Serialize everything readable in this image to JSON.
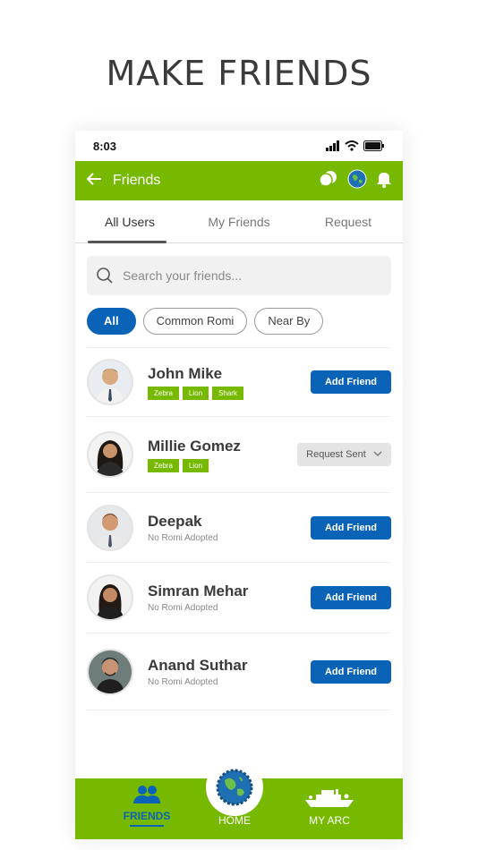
{
  "headline": "MAKE FRIENDS",
  "status": {
    "time": "8:03"
  },
  "appbar": {
    "title": "Friends"
  },
  "tabs": [
    {
      "label": "All Users",
      "active": true
    },
    {
      "label": "My Friends",
      "active": false
    },
    {
      "label": "Request",
      "active": false
    }
  ],
  "search": {
    "placeholder": "Search your friends..."
  },
  "filters": [
    {
      "label": "All",
      "active": true
    },
    {
      "label": "Common Romi",
      "active": false
    },
    {
      "label": "Near By",
      "active": false
    }
  ],
  "users": [
    {
      "name": "John Mike",
      "tags": [
        "Zebra",
        "Lion",
        "Shark"
      ],
      "subtitle": "",
      "action": "Add Friend"
    },
    {
      "name": "Millie Gomez",
      "tags": [
        "Zebra",
        "Lion"
      ],
      "subtitle": "",
      "action": "Request Sent"
    },
    {
      "name": "Deepak",
      "tags": [],
      "subtitle": "No Romi Adopted",
      "action": "Add Friend"
    },
    {
      "name": "Simran Mehar",
      "tags": [],
      "subtitle": "No Romi Adopted",
      "action": "Add Friend"
    },
    {
      "name": "Anand Suthar",
      "tags": [],
      "subtitle": "No Romi Adopted",
      "action": "Add Friend"
    }
  ],
  "bottom_nav": {
    "friends": "FRIENDS",
    "home": "HOME",
    "my_arc": "MY ARC"
  },
  "colors": {
    "brand_green": "#76b900",
    "primary_blue": "#0a63b6"
  },
  "icons": [
    "back-arrow-icon",
    "chat-icon",
    "globe-icon",
    "bell-icon",
    "search-icon",
    "chevron-down-icon",
    "friends-icon",
    "ark-ship-icon"
  ]
}
